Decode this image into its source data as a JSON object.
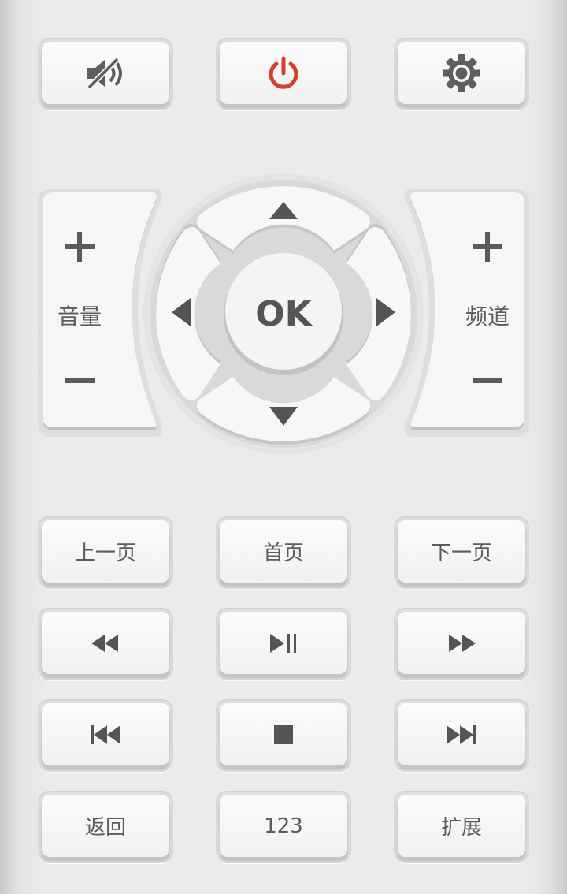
{
  "top_row": {
    "mute_icon": "mute-speaker-icon",
    "power_icon": "power-icon",
    "settings_icon": "gear-icon",
    "power_color": "#d6402a"
  },
  "volume": {
    "plus": "+",
    "label": "音量",
    "minus": "−"
  },
  "channel": {
    "plus": "+",
    "label": "频道",
    "minus": "−"
  },
  "dpad": {
    "ok": "OK"
  },
  "page_row": {
    "prev": "上一页",
    "home": "首页",
    "next": "下一页"
  },
  "transport_row1": {
    "rewind_icon": "rewind-icon",
    "play_pause_icon": "play-pause-icon",
    "fast_forward_icon": "fast-forward-icon"
  },
  "transport_row2": {
    "previous_icon": "skip-previous-icon",
    "stop_icon": "stop-icon",
    "next_icon": "skip-next-icon"
  },
  "bottom_row": {
    "back": "返回",
    "numbers": "123",
    "extend": "扩展"
  }
}
